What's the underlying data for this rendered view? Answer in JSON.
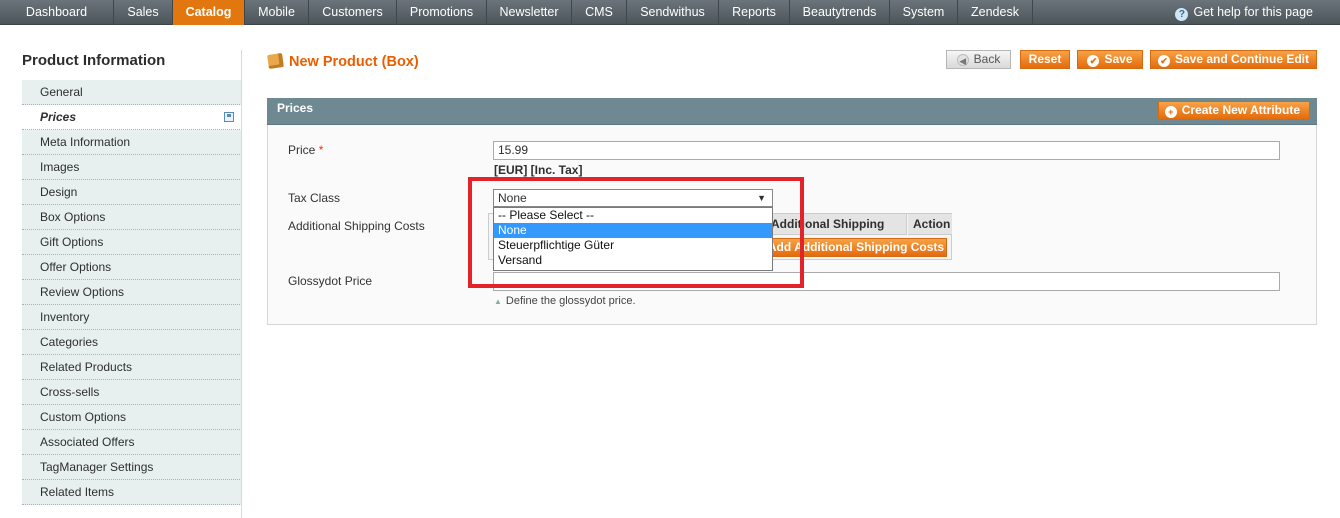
{
  "nav": {
    "items": [
      "Dashboard",
      "Sales",
      "Catalog",
      "Mobile",
      "Customers",
      "Promotions",
      "Newsletter",
      "CMS",
      "Sendwithus",
      "Reports",
      "Beautytrends",
      "System",
      "Zendesk"
    ],
    "active": "Catalog",
    "help": "Get help for this page"
  },
  "sidebar": {
    "title": "Product Information",
    "items": [
      "General",
      "Prices",
      "Meta Information",
      "Images",
      "Design",
      "Box Options",
      "Gift Options",
      "Offer Options",
      "Review Options",
      "Inventory",
      "Categories",
      "Related Products",
      "Cross-sells",
      "Custom Options",
      "Associated Offers",
      "TagManager Settings",
      "Related Items"
    ],
    "active": "Prices"
  },
  "header": {
    "title": "New Product (Box)",
    "buttons": {
      "back": "Back",
      "reset": "Reset",
      "save": "Save",
      "save_continue": "Save and Continue Edit"
    }
  },
  "fieldset": {
    "title": "Prices",
    "create_attribute": "Create New Attribute",
    "price": {
      "label": "Price",
      "value": "15.99",
      "note": "[EUR] [Inc. Tax]"
    },
    "tax_class": {
      "label": "Tax Class",
      "value": "None",
      "options": [
        "-- Please Select --",
        "None",
        "Steuerpflichtige Güter",
        "Versand"
      ],
      "highlighted": "None"
    },
    "shipping": {
      "label": "Additional Shipping Costs",
      "col_price": "Additional Shipping Price",
      "col_action": "Action",
      "add_button": "Add Additional Shipping Costs"
    },
    "glossydot": {
      "label": "Glossydot Price",
      "value": "",
      "hint": "Define the glossydot price."
    }
  },
  "colors": {
    "accent": "#eb5e00",
    "fieldset_header": "#6f8992",
    "highlight_box": "#e3232a",
    "selected_option": "#3399ff"
  }
}
